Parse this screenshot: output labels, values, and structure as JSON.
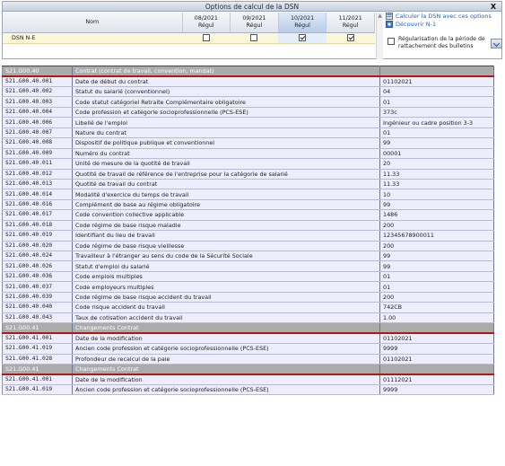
{
  "dialog": {
    "title": "Options de calcul de la DSN",
    "close_label": "X"
  },
  "options": {
    "name_header": "Nom",
    "months": [
      {
        "period": "08/2021",
        "regul": "Régul",
        "checked": false
      },
      {
        "period": "09/2021",
        "regul": "Régul",
        "checked": false
      },
      {
        "period": "10/2021",
        "regul": "Régul",
        "checked": true
      },
      {
        "period": "11/2021",
        "regul": "Régul",
        "checked": true
      }
    ],
    "row_label": "DSN N-E",
    "calc_link": "Calculer la DSN avec ces options",
    "discover_link": "Découvrir N-1",
    "regul_option": "Régularisation de la période de rattachement des bulletins"
  },
  "blocks": [
    {
      "code": "S21.G00.40",
      "title": "Contrat (contrat de travail, convention, mandat)",
      "rows": [
        {
          "code": "S21.G00.40.001",
          "label": "Date de début du contrat",
          "value": "01102021"
        },
        {
          "code": "S21.G00.40.002",
          "label": "Statut du salarié (conventionnel)",
          "value": "04"
        },
        {
          "code": "S21.G00.40.003",
          "label": "Code statut catégoriel Retraite Complémentaire obligatoire",
          "value": "01"
        },
        {
          "code": "S21.G00.40.004",
          "label": "Code profession et catégorie socioprofessionnelle (PCS-ESE)",
          "value": "373c"
        },
        {
          "code": "S21.G00.40.006",
          "label": "Libellé de l'emploi",
          "value": "Ingénieur ou cadre position 3-3"
        },
        {
          "code": "S21.G00.40.007",
          "label": "Nature du contrat",
          "value": "01"
        },
        {
          "code": "S21.G00.40.008",
          "label": "Dispositif de politique publique et conventionnel",
          "value": "99"
        },
        {
          "code": "S21.G00.40.009",
          "label": "Numéro du contrat",
          "value": "00001"
        },
        {
          "code": "S21.G00.40.011",
          "label": "Unité de mesure de la quotité de travail",
          "value": "20"
        },
        {
          "code": "S21.G00.40.012",
          "label": "Quotité de travail de référence de l'entreprise pour la catégorie de salarié",
          "value": "11.33"
        },
        {
          "code": "S21.G00.40.013",
          "label": "Quotité de travail du contrat",
          "value": "11.33"
        },
        {
          "code": "S21.G00.40.014",
          "label": "Modalité d'exercice du temps de travail",
          "value": "10"
        },
        {
          "code": "S21.G00.40.016",
          "label": "Complément de base au régime obligatoire",
          "value": "99"
        },
        {
          "code": "S21.G00.40.017",
          "label": "Code convention collective applicable",
          "value": "1486"
        },
        {
          "code": "S21.G00.40.018",
          "label": "Code régime de base risque maladie",
          "value": "200"
        },
        {
          "code": "S21.G00.40.019",
          "label": "Identifiant du lieu de travail",
          "value": "12345678900011"
        },
        {
          "code": "S21.G00.40.020",
          "label": "Code régime de base risque vieillesse",
          "value": "200"
        },
        {
          "code": "S21.G00.40.024",
          "label": "Travailleur à l'étranger au sens du code de la Sécurité Sociale",
          "value": "99"
        },
        {
          "code": "S21.G00.40.026",
          "label": "Statut d'emploi du salarié",
          "value": "99"
        },
        {
          "code": "S21.G00.40.036",
          "label": "Code emplois multiples",
          "value": "01"
        },
        {
          "code": "S21.G00.40.037",
          "label": "Code employeurs multiples",
          "value": "01"
        },
        {
          "code": "S21.G00.40.039",
          "label": "Code régime de base risque accident du travail",
          "value": "200"
        },
        {
          "code": "S21.G00.40.040",
          "label": "Code risque accident du travail",
          "value": "742CB"
        },
        {
          "code": "S21.G00.40.043",
          "label": "Taux de cotisation accident du travail",
          "value": "1.00"
        }
      ]
    },
    {
      "code": "S21.G00.41",
      "title": "Changements Contrat",
      "rows": [
        {
          "code": "S21.G00.41.001",
          "label": "Date de la modification",
          "value": "01102021"
        },
        {
          "code": "S21.G00.41.019",
          "label": "Ancien code profession et catégorie socioprofessionnelle (PCS-ESE)",
          "value": "9999"
        },
        {
          "code": "S21.G00.41.028",
          "label": "Profondeur de recalcul de la paie",
          "value": "01102021"
        }
      ]
    },
    {
      "code": "S21.G00.41",
      "title": "Changements Contrat",
      "rows": [
        {
          "code": "S21.G00.41.001",
          "label": "Date de la modification",
          "value": "01112021"
        },
        {
          "code": "S21.G00.41.019",
          "label": "Ancien code profession et catégorie socioprofessionnelle (PCS-ESE)",
          "value": "9999"
        }
      ]
    }
  ],
  "icons": {
    "calc": "calculator-icon",
    "discover": "discover-icon"
  },
  "colors": {
    "header_bg": "#ababab",
    "header_border": "#b01818",
    "row_bg": "#ededfb",
    "link": "#2a66b3",
    "option_row_bg": "#fdf6d9"
  }
}
